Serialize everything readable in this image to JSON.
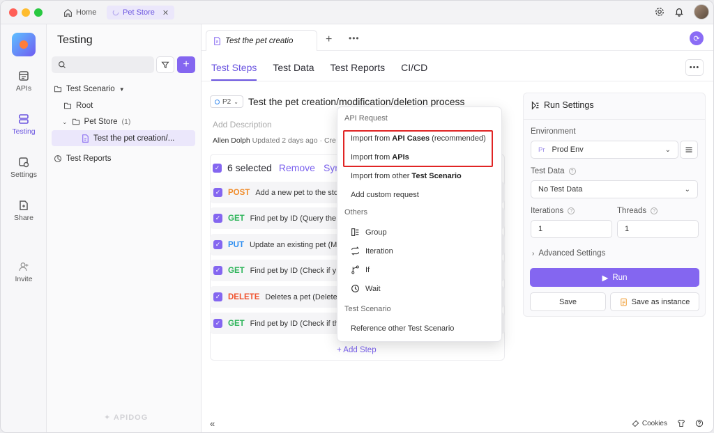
{
  "titlebar": {
    "home_label": "Home",
    "project_tab": "Pet Store"
  },
  "rail": {
    "apis": "APIs",
    "testing": "Testing",
    "settings": "Settings",
    "share": "Share",
    "invite": "Invite"
  },
  "panel": {
    "title": "Testing",
    "search_placeholder": "",
    "tree": {
      "scenario_group": "Test Scenario",
      "root": "Root",
      "pet_store": "Pet Store",
      "pet_store_count": "(1)",
      "scenario_item": "Test the pet creation/...",
      "reports": "Test Reports"
    },
    "watermark": "APIDOG"
  },
  "main": {
    "doc_tab": "Test the pet creatio",
    "tabs": [
      {
        "label": "Test Steps"
      },
      {
        "label": "Test Data"
      },
      {
        "label": "Test Reports"
      },
      {
        "label": "CI/CD"
      }
    ],
    "priority": "P2",
    "scenario_title": "Test the pet creation/modification/deletion process",
    "description_placeholder": "Add Description",
    "meta_author": "Allen Dolph",
    "meta_updated": "Updated 2 days ago",
    "meta_sep": "· Cre",
    "selected_label": "6 selected",
    "remove_label": "Remove",
    "sync_label": "Syn",
    "steps": [
      {
        "method": "POST",
        "summary": "Add a new pet to the sto"
      },
      {
        "method": "GET",
        "summary": "Find pet by ID (Query the"
      },
      {
        "method": "PUT",
        "summary": "Update an existing pet (M"
      },
      {
        "method": "GET",
        "summary": "Find pet by ID (Check if y"
      },
      {
        "method": "DELETE",
        "summary": "Deletes a pet (Delete"
      },
      {
        "method": "GET",
        "summary": "Find pet by ID (Check if th"
      }
    ],
    "add_step": "Add Step"
  },
  "dropdown": {
    "api_request_header": "API Request",
    "import_cases_prefix": "Import from ",
    "import_cases_bold": "API Cases",
    "import_cases_suffix": " (recommended)",
    "import_apis_prefix": "Import from ",
    "import_apis_bold": "APIs",
    "import_other_prefix": "Import from other ",
    "import_other_bold": "Test Scenario",
    "custom_request": "Add custom request",
    "others_header": "Others",
    "group": "Group",
    "iteration": "Iteration",
    "if": "If",
    "wait": "Wait",
    "scenario_header": "Test Scenario",
    "reference": "Reference other Test Scenario"
  },
  "run_settings": {
    "title": "Run Settings",
    "environment_label": "Environment",
    "env_badge": "Pr",
    "environment_value": "Prod Env",
    "test_data_label": "Test Data",
    "test_data_value": "No Test Data",
    "iterations_label": "Iterations",
    "iterations_value": "1",
    "threads_label": "Threads",
    "threads_value": "1",
    "advanced": "Advanced Settings",
    "run": "Run",
    "save": "Save",
    "save_instance": "Save as instance"
  },
  "footer": {
    "cookies": "Cookies"
  },
  "colors": {
    "accent": "#8466f0",
    "highlight": "#e02424"
  }
}
